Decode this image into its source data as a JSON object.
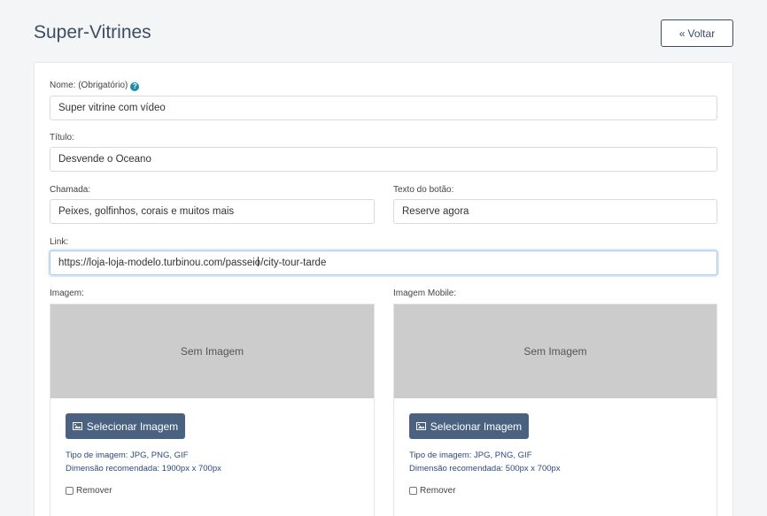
{
  "header": {
    "title": "Super-Vitrines",
    "back_label": "Voltar"
  },
  "form": {
    "nome": {
      "label": "Nome: (Obrigatório)",
      "help": "?",
      "value": "Super vitrine com vídeo"
    },
    "titulo": {
      "label": "Título:",
      "value": "Desvende o Oceano"
    },
    "chamada": {
      "label": "Chamada:",
      "value": "Peixes, golfinhos, corais e muitos mais"
    },
    "texto_botao": {
      "label": "Texto do botão:",
      "value": "Reserve agora"
    },
    "link": {
      "label": "Link:",
      "value": "https://loja-loja-modelo.turbinou.com/passeio/city-tour-tarde"
    }
  },
  "imagem": {
    "label": "Imagem:",
    "placeholder": "Sem Imagem",
    "button": "Selecionar Imagem",
    "tipo": "Tipo de imagem: JPG, PNG, GIF",
    "dimensao": "Dimensão recomendada: 1900px x 700px",
    "remover": "Remover"
  },
  "imagem_mobile": {
    "label": "Imagem Mobile:",
    "placeholder": "Sem Imagem",
    "button": "Selecionar Imagem",
    "tipo": "Tipo de imagem: JPG, PNG, GIF",
    "dimensao": "Dimensão recomendada: 500px x 700px",
    "remover": "Remover"
  },
  "icons": {
    "back": "double-chevron-left-icon",
    "help": "question-circle-icon",
    "image": "image-icon"
  },
  "colors": {
    "primary": "#4a6180",
    "title": "#3d4d63",
    "help": "#1a8ca8",
    "info_text": "#2d4a78",
    "placeholder_bg": "#cccccc"
  }
}
